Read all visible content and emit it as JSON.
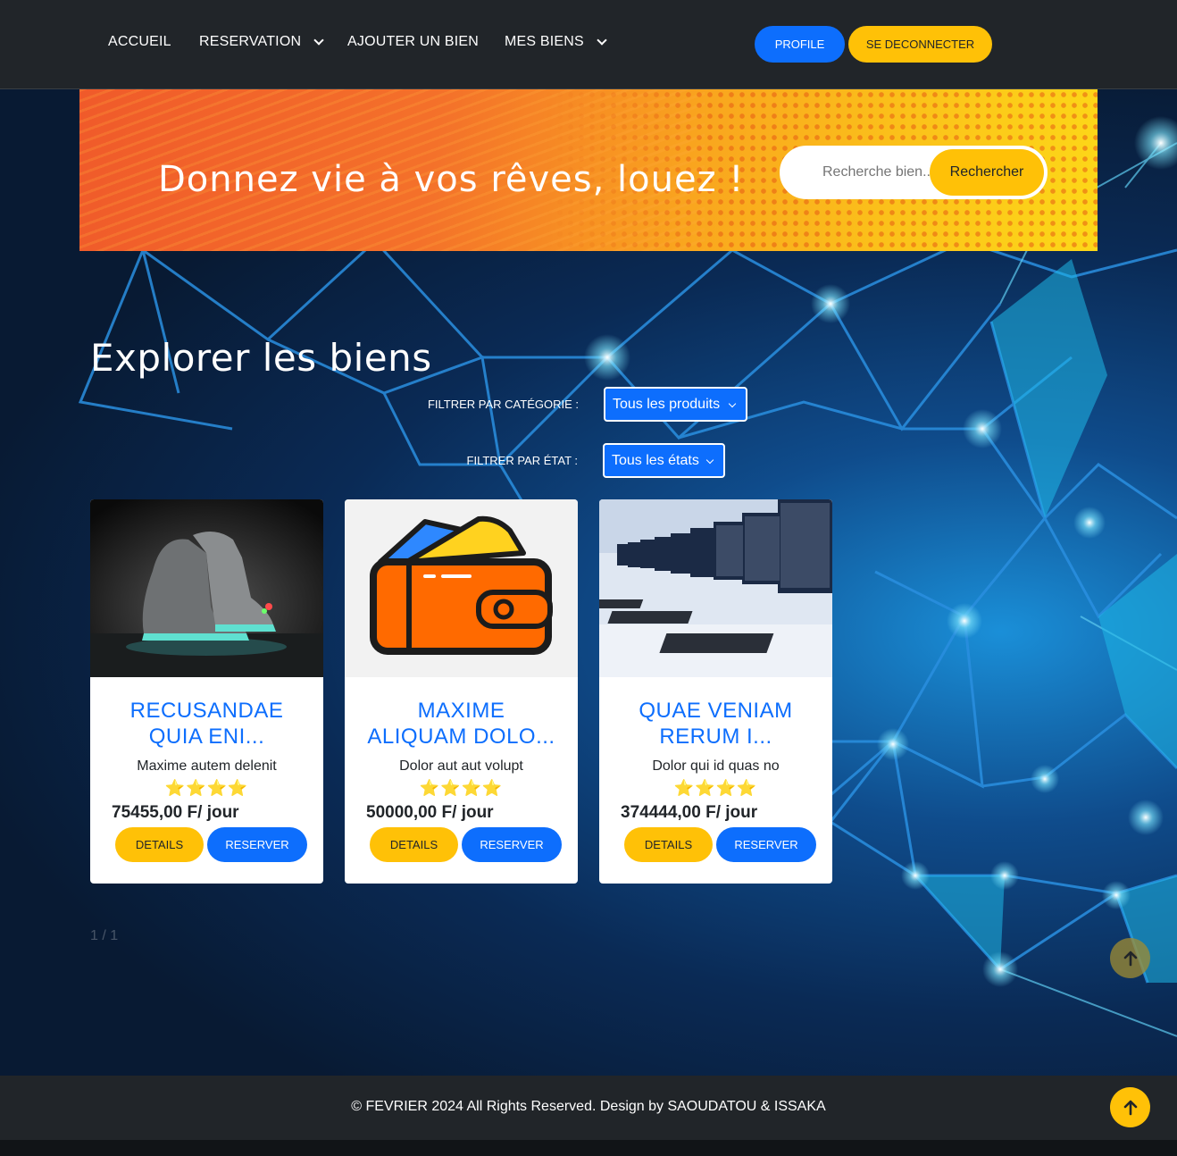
{
  "nav": {
    "items": [
      {
        "label": "ACCUEIL",
        "dropdown": false
      },
      {
        "label": "RESERVATION",
        "dropdown": true
      },
      {
        "label": "AJOUTER UN BIEN",
        "dropdown": false
      },
      {
        "label": "MES BIENS",
        "dropdown": true
      }
    ],
    "profile_label": "PROFILE",
    "logout_label": "SE DECONNECTER"
  },
  "banner": {
    "title": "Donnez vie à vos rêves, louez !",
    "search_placeholder": "Recherche bien...",
    "search_button": "Rechercher"
  },
  "section": {
    "title": "Explorer les biens",
    "filter_category_label": "FILTRER PAR CATÉGORIE :",
    "filter_category_value": "Tous les produits",
    "filter_state_label": "FILTRER PAR ÉTAT :",
    "filter_state_value": "Tous les états"
  },
  "cards": [
    {
      "title_line1": "RECUSANDAE",
      "title_line2": "QUIA ENI...",
      "desc": "Maxime autem delenit",
      "stars": "⭐⭐⭐⭐",
      "rating": 4,
      "price": "75455,00 F/ jour",
      "details": "DETAILS",
      "reserve": "RESERVER",
      "image": "sneakers-image"
    },
    {
      "title_line1": "MAXIME",
      "title_line2": "ALIQUAM DOLO...",
      "desc": "Dolor aut aut volupt",
      "stars": "⭐⭐⭐⭐",
      "rating": 4,
      "price": "50000,00 F/ jour",
      "details": "DETAILS",
      "reserve": "RESERVER",
      "image": "wallet-image"
    },
    {
      "title_line1": "QUAE VENIAM",
      "title_line2": "RERUM I...",
      "desc": "Dolor qui id quas no",
      "stars": "⭐⭐⭐⭐",
      "rating": 4,
      "price": "374444,00 F/ jour",
      "details": "DETAILS",
      "reserve": "RESERVER",
      "image": "computers-image"
    }
  ],
  "pager": "1 / 1",
  "footer": {
    "text": "© FEVRIER 2024 All Rights Reserved. Design by SAOUDATOU & ISSAKA"
  },
  "colors": {
    "primary": "#0d6efd",
    "accent": "#ffc107",
    "header_bg": "#212529"
  }
}
